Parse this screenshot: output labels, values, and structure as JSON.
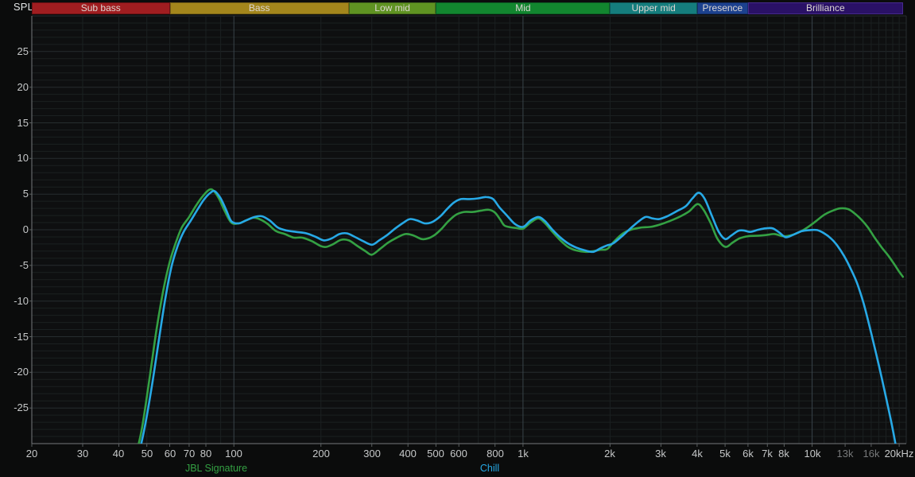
{
  "axis": {
    "y_title": "SPL",
    "y_ticks": [
      25,
      20,
      15,
      10,
      5,
      0,
      -5,
      -10,
      -15,
      -20,
      -25
    ],
    "x_ticks": [
      {
        "f": 20,
        "label": "20"
      },
      {
        "f": 30,
        "label": "30"
      },
      {
        "f": 40,
        "label": "40"
      },
      {
        "f": 50,
        "label": "50"
      },
      {
        "f": 60,
        "label": "60"
      },
      {
        "f": 70,
        "label": "70"
      },
      {
        "f": 80,
        "label": "80"
      },
      {
        "f": 100,
        "label": "100"
      },
      {
        "f": 200,
        "label": "200"
      },
      {
        "f": 300,
        "label": "300"
      },
      {
        "f": 400,
        "label": "400"
      },
      {
        "f": 500,
        "label": "500"
      },
      {
        "f": 600,
        "label": "600"
      },
      {
        "f": 800,
        "label": "800"
      },
      {
        "f": 1000,
        "label": "1k"
      },
      {
        "f": 2000,
        "label": "2k"
      },
      {
        "f": 3000,
        "label": "3k"
      },
      {
        "f": 4000,
        "label": "4k"
      },
      {
        "f": 5000,
        "label": "5k"
      },
      {
        "f": 6000,
        "label": "6k"
      },
      {
        "f": 7000,
        "label": "7k"
      },
      {
        "f": 8000,
        "label": "8k"
      },
      {
        "f": 10000,
        "label": "10k"
      },
      {
        "f": 13000,
        "label": "13k",
        "dim": true
      },
      {
        "f": 16000,
        "label": "16k",
        "dim": true
      },
      {
        "f": 20000,
        "label": "20kHz"
      }
    ]
  },
  "bands": [
    {
      "label": "Sub bass",
      "f_start": 20,
      "f_end": 60,
      "fill": "#a01d20",
      "border": "#6d1215"
    },
    {
      "label": "Bass",
      "f_start": 60,
      "f_end": 250,
      "fill": "#a3861c",
      "border": "#756016"
    },
    {
      "label": "Low mid",
      "f_start": 250,
      "f_end": 500,
      "fill": "#5f9322",
      "border": "#44691a"
    },
    {
      "label": "Mid",
      "f_start": 500,
      "f_end": 2000,
      "fill": "#12862f",
      "border": "#0d5e24"
    },
    {
      "label": "Upper mid",
      "f_start": 2000,
      "f_end": 4000,
      "fill": "#157d7d",
      "border": "#0f5a5a"
    },
    {
      "label": "Presence",
      "f_start": 4000,
      "f_end": 6000,
      "fill": "#1c418e",
      "border": "#142f66"
    },
    {
      "label": "Brilliance",
      "f_start": 6000,
      "f_end": 20600,
      "fill": "#2a1166",
      "border": "#462b8e"
    }
  ],
  "chart_data": {
    "type": "line",
    "x_scale": "log",
    "xlim": [
      20,
      20600
    ],
    "ylim": [
      -30,
      30
    ],
    "ylabel": "SPL",
    "grid": "on",
    "legend_position": "bottom",
    "series": [
      {
        "name": "JBL Signature",
        "color": "#34a143",
        "points": [
          [
            45,
            -33
          ],
          [
            48,
            -28
          ],
          [
            51,
            -21
          ],
          [
            54,
            -14
          ],
          [
            57,
            -8.5
          ],
          [
            60,
            -4.5
          ],
          [
            63,
            -1.8
          ],
          [
            66,
            0.3
          ],
          [
            70,
            1.8
          ],
          [
            74,
            3.4
          ],
          [
            78,
            4.7
          ],
          [
            82,
            5.6
          ],
          [
            85,
            5.5
          ],
          [
            89,
            4.3
          ],
          [
            93,
            2.6
          ],
          [
            98,
            1.0
          ],
          [
            104,
            0.9
          ],
          [
            110,
            1.3
          ],
          [
            117,
            1.7
          ],
          [
            124,
            1.4
          ],
          [
            131,
            0.8
          ],
          [
            140,
            -0.2
          ],
          [
            150,
            -0.6
          ],
          [
            161,
            -1.1
          ],
          [
            172,
            -1.1
          ],
          [
            186,
            -1.6
          ],
          [
            200,
            -2.3
          ],
          [
            209,
            -2.4
          ],
          [
            221,
            -2.0
          ],
          [
            235,
            -1.4
          ],
          [
            250,
            -1.5
          ],
          [
            268,
            -2.3
          ],
          [
            285,
            -3.0
          ],
          [
            300,
            -3.5
          ],
          [
            320,
            -2.7
          ],
          [
            342,
            -1.8
          ],
          [
            366,
            -1.1
          ],
          [
            392,
            -0.6
          ],
          [
            418,
            -0.8
          ],
          [
            446,
            -1.3
          ],
          [
            470,
            -1.2
          ],
          [
            496,
            -0.7
          ],
          [
            522,
            0.1
          ],
          [
            552,
            1.2
          ],
          [
            586,
            2.1
          ],
          [
            625,
            2.5
          ],
          [
            672,
            2.5
          ],
          [
            720,
            2.7
          ],
          [
            762,
            2.8
          ],
          [
            800,
            2.4
          ],
          [
            835,
            1.4
          ],
          [
            862,
            0.6
          ],
          [
            905,
            0.35
          ],
          [
            950,
            0.25
          ],
          [
            1000,
            0.15
          ],
          [
            1062,
            1.0
          ],
          [
            1130,
            1.6
          ],
          [
            1192,
            0.9
          ],
          [
            1258,
            -0.2
          ],
          [
            1340,
            -1.4
          ],
          [
            1430,
            -2.4
          ],
          [
            1528,
            -2.9
          ],
          [
            1648,
            -3.1
          ],
          [
            1752,
            -3.0
          ],
          [
            1855,
            -2.8
          ],
          [
            1955,
            -2.7
          ],
          [
            2060,
            -1.7
          ],
          [
            2200,
            -0.6
          ],
          [
            2360,
            0.0
          ],
          [
            2550,
            0.3
          ],
          [
            2760,
            0.4
          ],
          [
            2960,
            0.7
          ],
          [
            3210,
            1.2
          ],
          [
            3510,
            1.9
          ],
          [
            3760,
            2.6
          ],
          [
            4010,
            3.6
          ],
          [
            4210,
            2.8
          ],
          [
            4460,
            0.9
          ],
          [
            4710,
            -1.3
          ],
          [
            5010,
            -2.4
          ],
          [
            5310,
            -1.8
          ],
          [
            5610,
            -1.2
          ],
          [
            6010,
            -0.9
          ],
          [
            6410,
            -0.85
          ],
          [
            6910,
            -0.75
          ],
          [
            7410,
            -0.6
          ],
          [
            7910,
            -0.9
          ],
          [
            8410,
            -0.8
          ],
          [
            9010,
            -0.35
          ],
          [
            9610,
            0.3
          ],
          [
            10310,
            1.2
          ],
          [
            11010,
            2.1
          ],
          [
            11810,
            2.7
          ],
          [
            12510,
            3.0
          ],
          [
            13310,
            2.9
          ],
          [
            14010,
            2.3
          ],
          [
            14810,
            1.4
          ],
          [
            15610,
            0.3
          ],
          [
            16510,
            -1.2
          ],
          [
            17410,
            -2.5
          ],
          [
            18310,
            -3.6
          ],
          [
            19210,
            -4.8
          ],
          [
            20010,
            -5.9
          ],
          [
            20610,
            -6.6
          ]
        ]
      },
      {
        "name": "Chill",
        "color": "#27a9e6",
        "points": [
          [
            46,
            -33
          ],
          [
            49,
            -28
          ],
          [
            52,
            -22
          ],
          [
            55,
            -15.5
          ],
          [
            58,
            -9.5
          ],
          [
            61,
            -5.0
          ],
          [
            64,
            -2.2
          ],
          [
            67,
            -0.3
          ],
          [
            71,
            1.3
          ],
          [
            75,
            2.9
          ],
          [
            79,
            4.3
          ],
          [
            83,
            5.2
          ],
          [
            86,
            5.4
          ],
          [
            90,
            4.4
          ],
          [
            94,
            2.8
          ],
          [
            98,
            1.2
          ],
          [
            104,
            0.9
          ],
          [
            110,
            1.3
          ],
          [
            118,
            1.8
          ],
          [
            125,
            1.9
          ],
          [
            133,
            1.3
          ],
          [
            142,
            0.3
          ],
          [
            152,
            -0.1
          ],
          [
            164,
            -0.3
          ],
          [
            178,
            -0.5
          ],
          [
            192,
            -1.0
          ],
          [
            205,
            -1.5
          ],
          [
            218,
            -1.2
          ],
          [
            232,
            -0.6
          ],
          [
            246,
            -0.5
          ],
          [
            262,
            -1.0
          ],
          [
            280,
            -1.6
          ],
          [
            300,
            -2.1
          ],
          [
            318,
            -1.5
          ],
          [
            340,
            -0.7
          ],
          [
            362,
            0.2
          ],
          [
            386,
            1.0
          ],
          [
            406,
            1.5
          ],
          [
            430,
            1.3
          ],
          [
            456,
            0.9
          ],
          [
            480,
            1.0
          ],
          [
            500,
            1.4
          ],
          [
            521,
            2.0
          ],
          [
            546,
            2.9
          ],
          [
            576,
            3.8
          ],
          [
            610,
            4.3
          ],
          [
            652,
            4.3
          ],
          [
            700,
            4.4
          ],
          [
            745,
            4.6
          ],
          [
            788,
            4.3
          ],
          [
            830,
            3.1
          ],
          [
            880,
            2.0
          ],
          [
            938,
            0.8
          ],
          [
            1000,
            0.4
          ],
          [
            1062,
            1.3
          ],
          [
            1130,
            1.8
          ],
          [
            1192,
            1.2
          ],
          [
            1258,
            0.1
          ],
          [
            1340,
            -1.0
          ],
          [
            1430,
            -1.9
          ],
          [
            1528,
            -2.5
          ],
          [
            1640,
            -2.9
          ],
          [
            1750,
            -3.1
          ],
          [
            1852,
            -2.6
          ],
          [
            1952,
            -2.2
          ],
          [
            2052,
            -1.9
          ],
          [
            2200,
            -0.9
          ],
          [
            2355,
            0.2
          ],
          [
            2500,
            1.1
          ],
          [
            2655,
            1.8
          ],
          [
            2800,
            1.6
          ],
          [
            2955,
            1.5
          ],
          [
            3155,
            1.9
          ],
          [
            3400,
            2.6
          ],
          [
            3655,
            3.3
          ],
          [
            3855,
            4.4
          ],
          [
            4055,
            5.2
          ],
          [
            4255,
            4.3
          ],
          [
            4505,
            1.9
          ],
          [
            4755,
            -0.3
          ],
          [
            5005,
            -1.3
          ],
          [
            5255,
            -0.8
          ],
          [
            5555,
            -0.15
          ],
          [
            5805,
            -0.1
          ],
          [
            6105,
            -0.3
          ],
          [
            6505,
            0.0
          ],
          [
            6905,
            0.2
          ],
          [
            7305,
            0.2
          ],
          [
            7705,
            -0.4
          ],
          [
            8105,
            -1.05
          ],
          [
            8605,
            -0.7
          ],
          [
            9205,
            -0.2
          ],
          [
            9805,
            -0.05
          ],
          [
            10405,
            -0.05
          ],
          [
            11005,
            -0.5
          ],
          [
            11605,
            -1.2
          ],
          [
            12205,
            -2.2
          ],
          [
            12905,
            -3.7
          ],
          [
            13605,
            -5.5
          ],
          [
            14305,
            -7.5
          ],
          [
            15105,
            -10.5
          ],
          [
            16005,
            -14.5
          ],
          [
            17005,
            -19.0
          ],
          [
            18005,
            -23.5
          ],
          [
            19005,
            -28.0
          ],
          [
            19705,
            -31.5
          ]
        ]
      }
    ]
  }
}
